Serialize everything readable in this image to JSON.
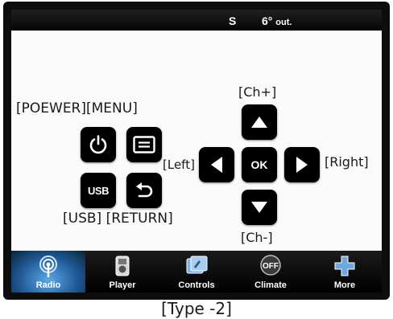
{
  "status_bar": {
    "direction": "S",
    "temperature": "6°",
    "temperature_suffix": "out."
  },
  "remote": {
    "labels": {
      "power_menu": "[POEWER][MENU]",
      "usb_return": "[USB] [RETURN]",
      "ch_up": "[Ch+]",
      "ch_down": "[Ch-]",
      "left": "[Left]",
      "right": "[Right]"
    },
    "buttons": {
      "usb": "USB",
      "ok": "OK"
    }
  },
  "nav": {
    "items": [
      {
        "label": "Radio",
        "icon": "radio-icon",
        "active": true
      },
      {
        "label": "Player",
        "icon": "player-icon",
        "active": false
      },
      {
        "label": "Controls",
        "icon": "controls-icon",
        "active": false
      },
      {
        "label": "Climate",
        "icon": "climate-off-icon",
        "active": false
      },
      {
        "label": "More",
        "icon": "plus-icon",
        "active": false
      }
    ],
    "climate_badge": "OFF"
  },
  "caption": "[Type -2]",
  "colors": {
    "button_bg": "#000000",
    "nav_active": "#3a86c8",
    "screen_bg": "#fafafa"
  }
}
